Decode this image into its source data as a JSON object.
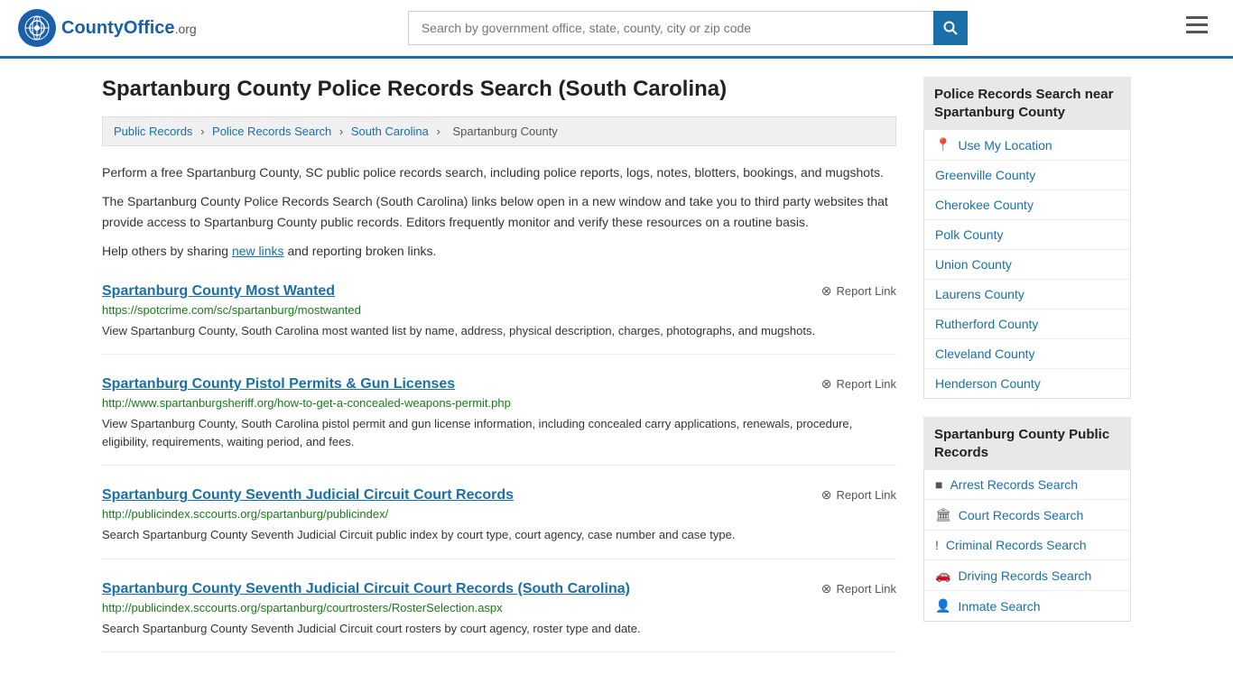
{
  "header": {
    "logo_text": "CountyOffice",
    "logo_suffix": ".org",
    "search_placeholder": "Search by government office, state, county, city or zip code",
    "search_value": ""
  },
  "page": {
    "title": "Spartanburg County Police Records Search (South Carolina)",
    "breadcrumb": [
      {
        "label": "Public Records",
        "url": "#"
      },
      {
        "label": "Police Records Search",
        "url": "#"
      },
      {
        "label": "South Carolina",
        "url": "#"
      },
      {
        "label": "Spartanburg County",
        "url": "#"
      }
    ],
    "description1": "Perform a free Spartanburg County, SC public police records search, including police reports, logs, notes, blotters, bookings, and mugshots.",
    "description2": "The Spartanburg County Police Records Search (South Carolina) links below open in a new window and take you to third party websites that provide access to Spartanburg County public records. Editors frequently monitor and verify these resources on a routine basis.",
    "description3_pre": "Help others by sharing ",
    "description3_link": "new links",
    "description3_post": " and reporting broken links."
  },
  "results": [
    {
      "title": "Spartanburg County Most Wanted",
      "url": "https://spotcrime.com/sc/spartanburg/mostwanted",
      "desc": "View Spartanburg County, South Carolina most wanted list by name, address, physical description, charges, photographs, and mugshots.",
      "report": "Report Link"
    },
    {
      "title": "Spartanburg County Pistol Permits & Gun Licenses",
      "url": "http://www.spartanburgsheriff.org/how-to-get-a-concealed-weapons-permit.php",
      "desc": "View Spartanburg County, South Carolina pistol permit and gun license information, including concealed carry applications, renewals, procedure, eligibility, requirements, waiting period, and fees.",
      "report": "Report Link"
    },
    {
      "title": "Spartanburg County Seventh Judicial Circuit Court Records",
      "url": "http://publicindex.sccourts.org/spartanburg/publicindex/",
      "desc": "Search Spartanburg County Seventh Judicial Circuit public index by court type, court agency, case number and case type.",
      "report": "Report Link"
    },
    {
      "title": "Spartanburg County Seventh Judicial Circuit Court Records (South Carolina)",
      "url": "http://publicindex.sccourts.org/spartanburg/courtrosters/RosterSelection.aspx",
      "desc": "Search Spartanburg County Seventh Judicial Circuit court rosters by court agency, roster type and date.",
      "report": "Report Link"
    }
  ],
  "sidebar": {
    "nearby_title": "Police Records Search near Spartanburg County",
    "use_my_location": "Use My Location",
    "nearby_counties": [
      "Greenville County",
      "Cherokee County",
      "Polk County",
      "Union County",
      "Laurens County",
      "Rutherford County",
      "Cleveland County",
      "Henderson County"
    ],
    "public_records_title": "Spartanburg County Public Records",
    "public_records": [
      {
        "icon": "■",
        "label": "Arrest Records Search"
      },
      {
        "icon": "🏛",
        "label": "Court Records Search"
      },
      {
        "icon": "!",
        "label": "Criminal Records Search"
      },
      {
        "icon": "🚗",
        "label": "Driving Records Search"
      },
      {
        "icon": "👤",
        "label": "Inmate Search"
      }
    ]
  }
}
